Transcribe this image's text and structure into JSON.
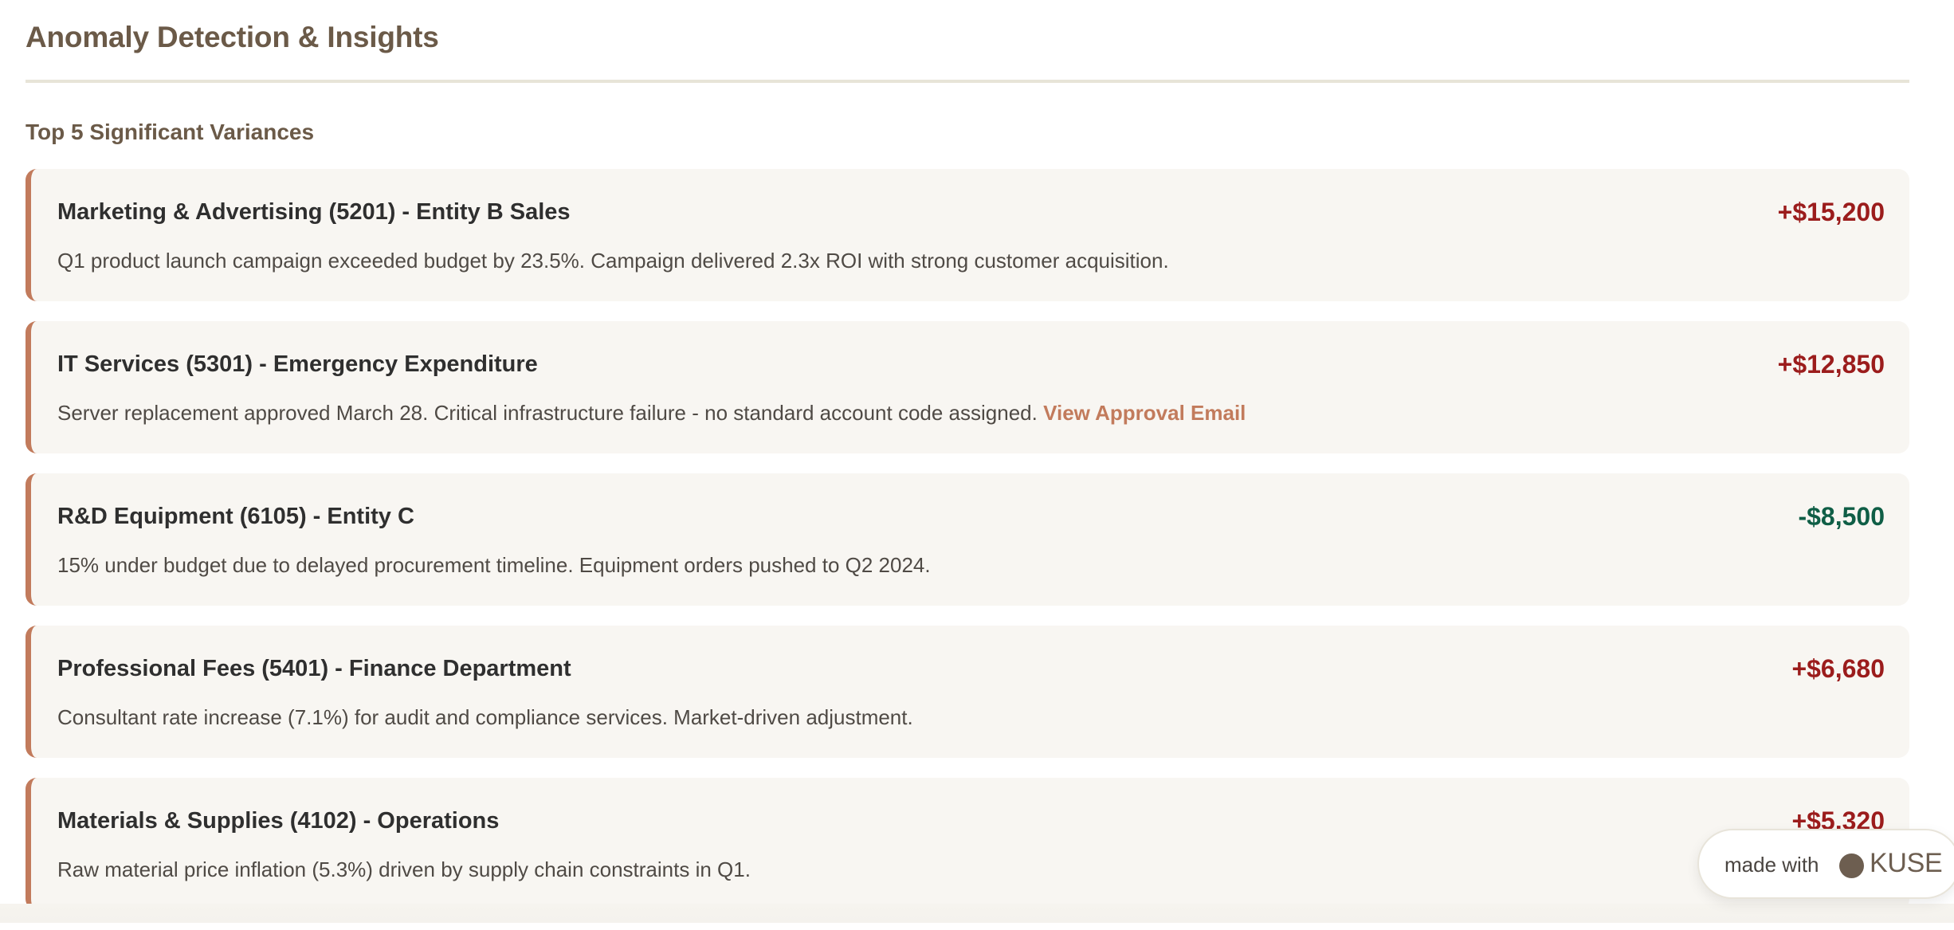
{
  "page": {
    "title": "Anomaly Detection & Insights",
    "subtitle": "Top 5 Significant Variances"
  },
  "variances": [
    {
      "name": "Marketing & Advertising (5201) - Entity B Sales",
      "amount": "+$15,200",
      "direction": "increase",
      "description": "Q1 product launch campaign exceeded budget by 23.5%. Campaign delivered 2.3x ROI with strong customer acquisition."
    },
    {
      "name": "IT Services (5301) - Emergency Expenditure",
      "amount": "+$12,850",
      "direction": "increase",
      "description": "Server replacement approved March 28. Critical infrastructure failure - no standard account code assigned.",
      "link": "View Approval Email"
    },
    {
      "name": "R&D Equipment (6105) - Entity C",
      "amount": "-$8,500",
      "direction": "decrease",
      "description": "15% under budget due to delayed procurement timeline. Equipment orders pushed to Q2 2024."
    },
    {
      "name": "Professional Fees (5401) - Finance Department",
      "amount": "+$6,680",
      "direction": "increase",
      "description": "Consultant rate increase (7.1%) for audit and compliance services. Market-driven adjustment."
    },
    {
      "name": "Materials & Supplies (4102) - Operations",
      "amount": "+$5,320",
      "direction": "increase",
      "description": "Raw material price inflation (5.3%) driven by supply chain constraints in Q1."
    }
  ],
  "badge": {
    "prefix": "made with",
    "brand": "KUSE"
  },
  "colors": {
    "accent": "#c27b5c",
    "increase": "#9b1c1c",
    "decrease": "#0f5e46",
    "heading": "#6b5a48",
    "card_background": "#f8f6f2"
  },
  "icons": {
    "brand_logo": "kuse-logo-dot"
  }
}
